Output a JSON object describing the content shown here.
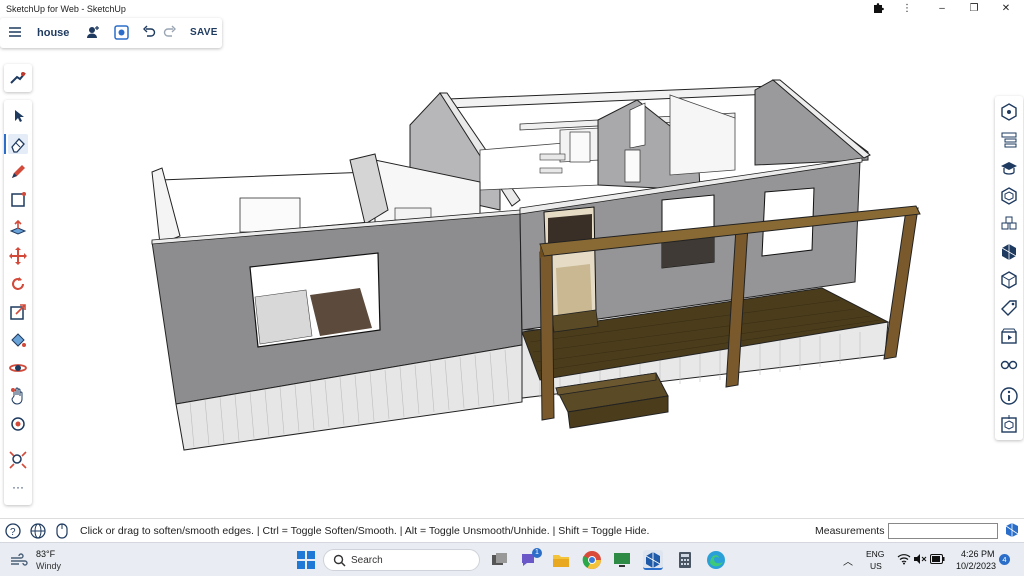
{
  "window": {
    "title": "SketchUp for Web - SketchUp",
    "controls": {
      "extensions_icon": "puzzle-icon",
      "menu_icon": "more-vert-icon",
      "minimize": "–",
      "maximize": "❐",
      "close": "✕"
    }
  },
  "topbar": {
    "menu_icon": "hamburger-icon",
    "project_name": "house",
    "share_icon": "add-user-icon",
    "scene_icon": "scene-icon",
    "undo_icon": "undo-icon",
    "redo_icon": "redo-icon",
    "save_label": "SAVE"
  },
  "left_toolbar": {
    "top_tool": "search-tool-icon",
    "tools": [
      "select",
      "eraser",
      "pencil",
      "rectangle",
      "push-pull",
      "move",
      "rotate",
      "scale",
      "paint-bucket",
      "orbit-tape",
      "pan",
      "dimension",
      "zoom-extents"
    ],
    "more_label": "···"
  },
  "right_toolbar": {
    "panels": [
      "entity-info",
      "outliner",
      "instructor",
      "components",
      "materials",
      "styles",
      "layers",
      "tags",
      "scenes",
      "display",
      "info",
      "3d-warehouse"
    ]
  },
  "status": {
    "hint": "Click or drag to soften/smooth edges. | Ctrl = Toggle Soften/Smooth. | Alt = Toggle Unsmooth/Unhide. | Shift = Toggle Hide.",
    "measurements_label": "Measurements",
    "measurements_value": ""
  },
  "taskbar": {
    "weather_temp": "83°F",
    "weather_desc": "Windy",
    "search_label": "Search",
    "lang": "ENG",
    "region": "US",
    "time": "4:26 PM",
    "date": "10/2/2023",
    "notification_count": "4",
    "chat_badge": "1"
  },
  "colors": {
    "accent": "#2a6ec9",
    "wall": "#8d8d8f",
    "wall_light": "#a5a5a7",
    "wood_deck": "#4b3d1c",
    "beam": "#7a5a2c",
    "siding": "#e6e6e6"
  }
}
